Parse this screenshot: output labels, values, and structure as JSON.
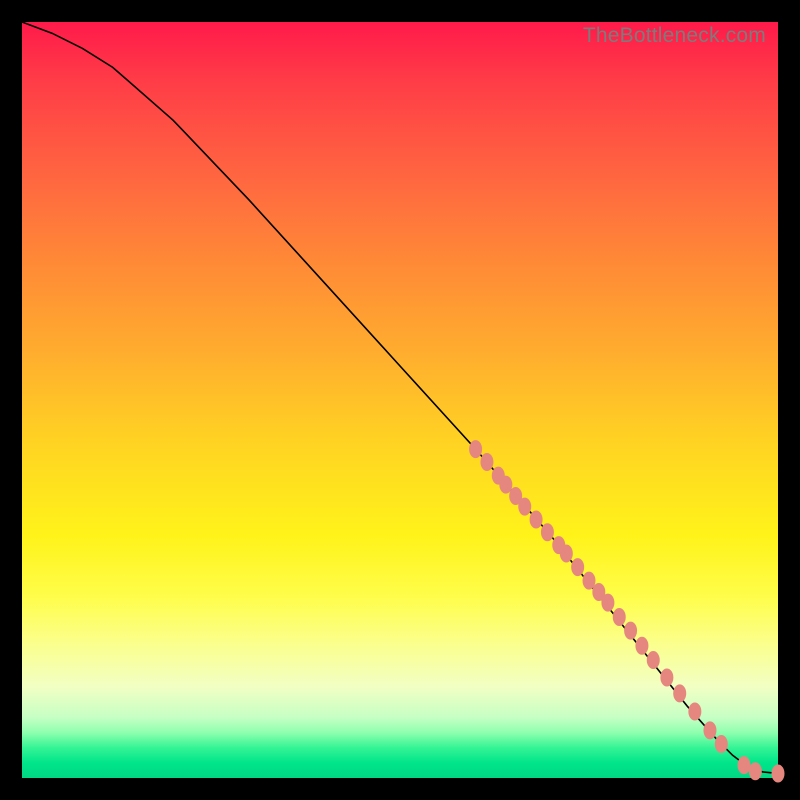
{
  "watermark": "TheBottleneck.com",
  "colors": {
    "dot": "#e6877f",
    "curve": "#000000"
  },
  "chart_data": {
    "type": "line",
    "title": "",
    "xlabel": "",
    "ylabel": "",
    "xlim": [
      0,
      100
    ],
    "ylim": [
      0,
      100
    ],
    "curve": {
      "x": [
        0,
        4,
        8,
        12,
        20,
        30,
        40,
        50,
        60,
        70,
        78,
        84,
        88,
        92,
        94,
        96,
        98,
        100
      ],
      "y": [
        100,
        98.5,
        96.5,
        94,
        87,
        76.5,
        65.5,
        54.5,
        43.5,
        32,
        22,
        14.5,
        9.5,
        5,
        3,
        1.5,
        0.8,
        0.6
      ]
    },
    "scatter": {
      "x": [
        60,
        61.5,
        63,
        64,
        65.3,
        66.5,
        68,
        69.5,
        71,
        72,
        73.5,
        75,
        76.3,
        77.5,
        79,
        80.5,
        82,
        83.5,
        85.3,
        87,
        89,
        91,
        92.5,
        95.5,
        97,
        100
      ],
      "y": [
        43.5,
        41.8,
        40,
        38.8,
        37.3,
        35.9,
        34.2,
        32.5,
        30.8,
        29.7,
        27.9,
        26.1,
        24.6,
        23.2,
        21.3,
        19.5,
        17.5,
        15.6,
        13.3,
        11.2,
        8.8,
        6.3,
        4.5,
        1.7,
        0.9,
        0.6
      ]
    }
  }
}
